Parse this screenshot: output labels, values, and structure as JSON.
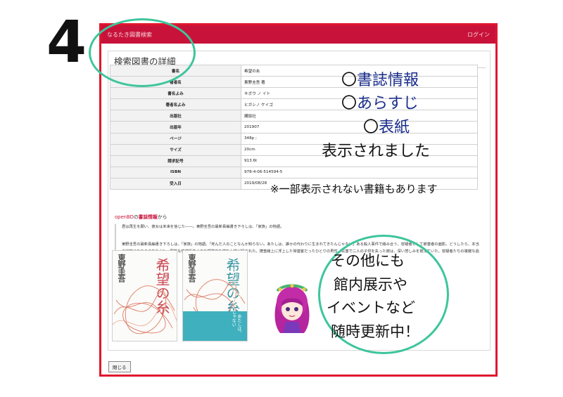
{
  "step_number": "4",
  "app": {
    "title": "なるたき図書検索",
    "login_label": "ログイン"
  },
  "panel": {
    "title": "検索図書の詳細"
  },
  "biblio": [
    {
      "label": "書名",
      "value": "希望の糸"
    },
    {
      "label": "著者名",
      "value": "東野圭吾 著"
    },
    {
      "label": "書名よみ",
      "value": "キボウ ノ イト"
    },
    {
      "label": "著者名よみ",
      "value": "ヒガシノ ケイゴ"
    },
    {
      "label": "出版社",
      "value": "講談社"
    },
    {
      "label": "出版年",
      "value": "201907"
    },
    {
      "label": "ページ",
      "value": "348p ;"
    },
    {
      "label": "サイズ",
      "value": "20cm"
    },
    {
      "label": "請求記号",
      "value": "913.6t"
    },
    {
      "label": "ISBN",
      "value": "978-4-06-514594-5"
    },
    {
      "label": "受入日",
      "value": "2019/08/28"
    }
  ],
  "openbd": {
    "prefix": "openBD",
    "middle": "の",
    "link": "書誌情報",
    "suffix": "から"
  },
  "synopsis": {
    "p1": "君は再生を願い、彼女は未来を信じた――。東野圭吾の最新長編書き下ろしは、「家族」の物語。",
    "p2": "東野圭吾の最新長編書き下ろしは、「家族」の物語。「死んだ人のことなんか知らない。あたしは、誰かの代わりに生まれてきたんじゃない」ある殺人事件で絡み合う、容疑者そして被害者の面影。どうしたら、本当の家族になれるのだろう？　閑静な住宅街で小さな喫茶店を営む女性が殺された。捜査線上に浮上した常連客だったひとりの男性。災害で二人の子供を失った彼は、深い悲しみを抱えていた。容疑者たちの複雑な過去に、若き刑事が挑む。"
  },
  "covers": [
    {
      "author": "東野圭吾",
      "title": "希望の糸"
    },
    {
      "author": "東野圭吾",
      "title": "希望の糸",
      "obi": "死んだ人のことなんか知らない。あたしは、誰かの代わりに生まれてきたんじゃない"
    }
  ],
  "close_label": "閉じる",
  "annotations": {
    "item1": "書誌情報",
    "item2": "あらすじ",
    "item3": "表紙",
    "item_marker": "〇",
    "summary": "表示されました",
    "note": "※一部表示されない書籍もあります",
    "bubble": [
      "その他にも",
      "館内展示や",
      "イベントなど",
      "随時更新中！"
    ]
  },
  "colors": {
    "brand_red": "#c8123a",
    "frame_red": "#e0172d",
    "annotation_blue": "#1a2d8c",
    "circle_green": "#3ec59c"
  }
}
